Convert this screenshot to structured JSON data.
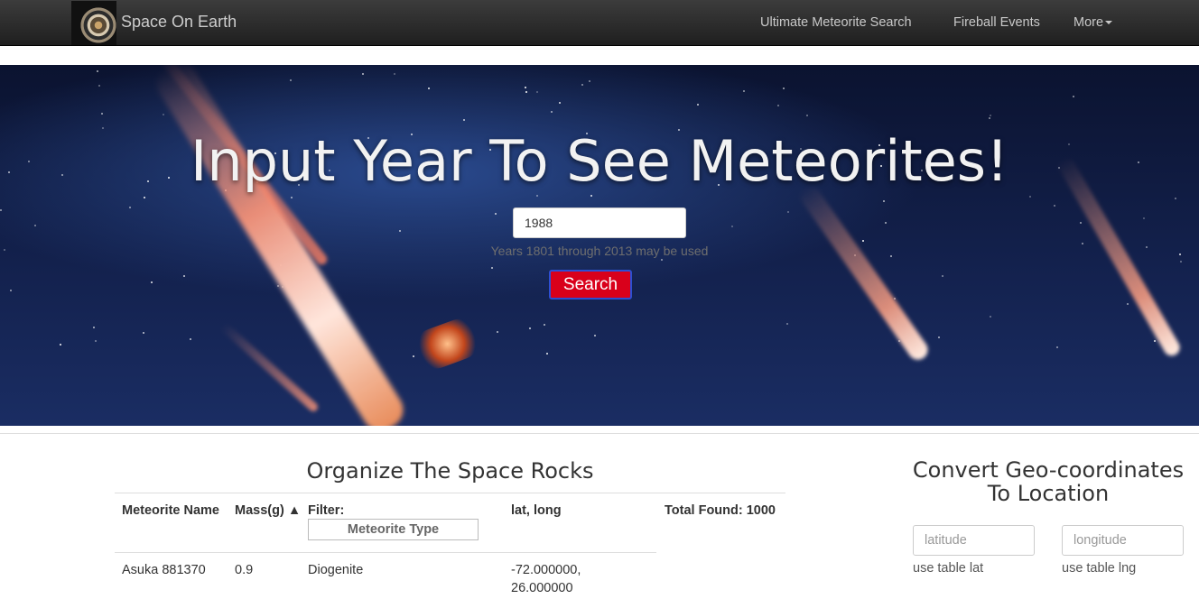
{
  "nav": {
    "brand": "Space On Earth",
    "links": [
      {
        "label": "Ultimate Meteorite Search"
      },
      {
        "label": "Fireball Events"
      },
      {
        "label": "More"
      }
    ]
  },
  "hero": {
    "title": "Input Year To See Meteorites!",
    "year_value": "1988",
    "help_text": "Years 1801 through 2013 may be used",
    "search_label": "Search"
  },
  "table": {
    "title": "Organize The Space Rocks",
    "headers": {
      "name": "Meteorite Name",
      "mass": "Mass(g) ▲",
      "filter": "Filter:",
      "filter_value": "Meteorite Type",
      "latlong": "lat, long",
      "total": "Total Found: 1000"
    },
    "rows": [
      {
        "name": "Asuka 881370",
        "mass": "0.9",
        "type": "Diogenite",
        "latlong": "-72.000000, 26.000000"
      }
    ]
  },
  "geo": {
    "title": "Convert Geo-coordinates To Location",
    "lat_placeholder": "latitude",
    "lng_placeholder": "longitude",
    "lat_help": "use table lat",
    "lng_help": "use table lng"
  },
  "colors": {
    "search_button": "#d9001b",
    "search_border": "#2d4fd3",
    "navbar": "#2a2a2a"
  }
}
